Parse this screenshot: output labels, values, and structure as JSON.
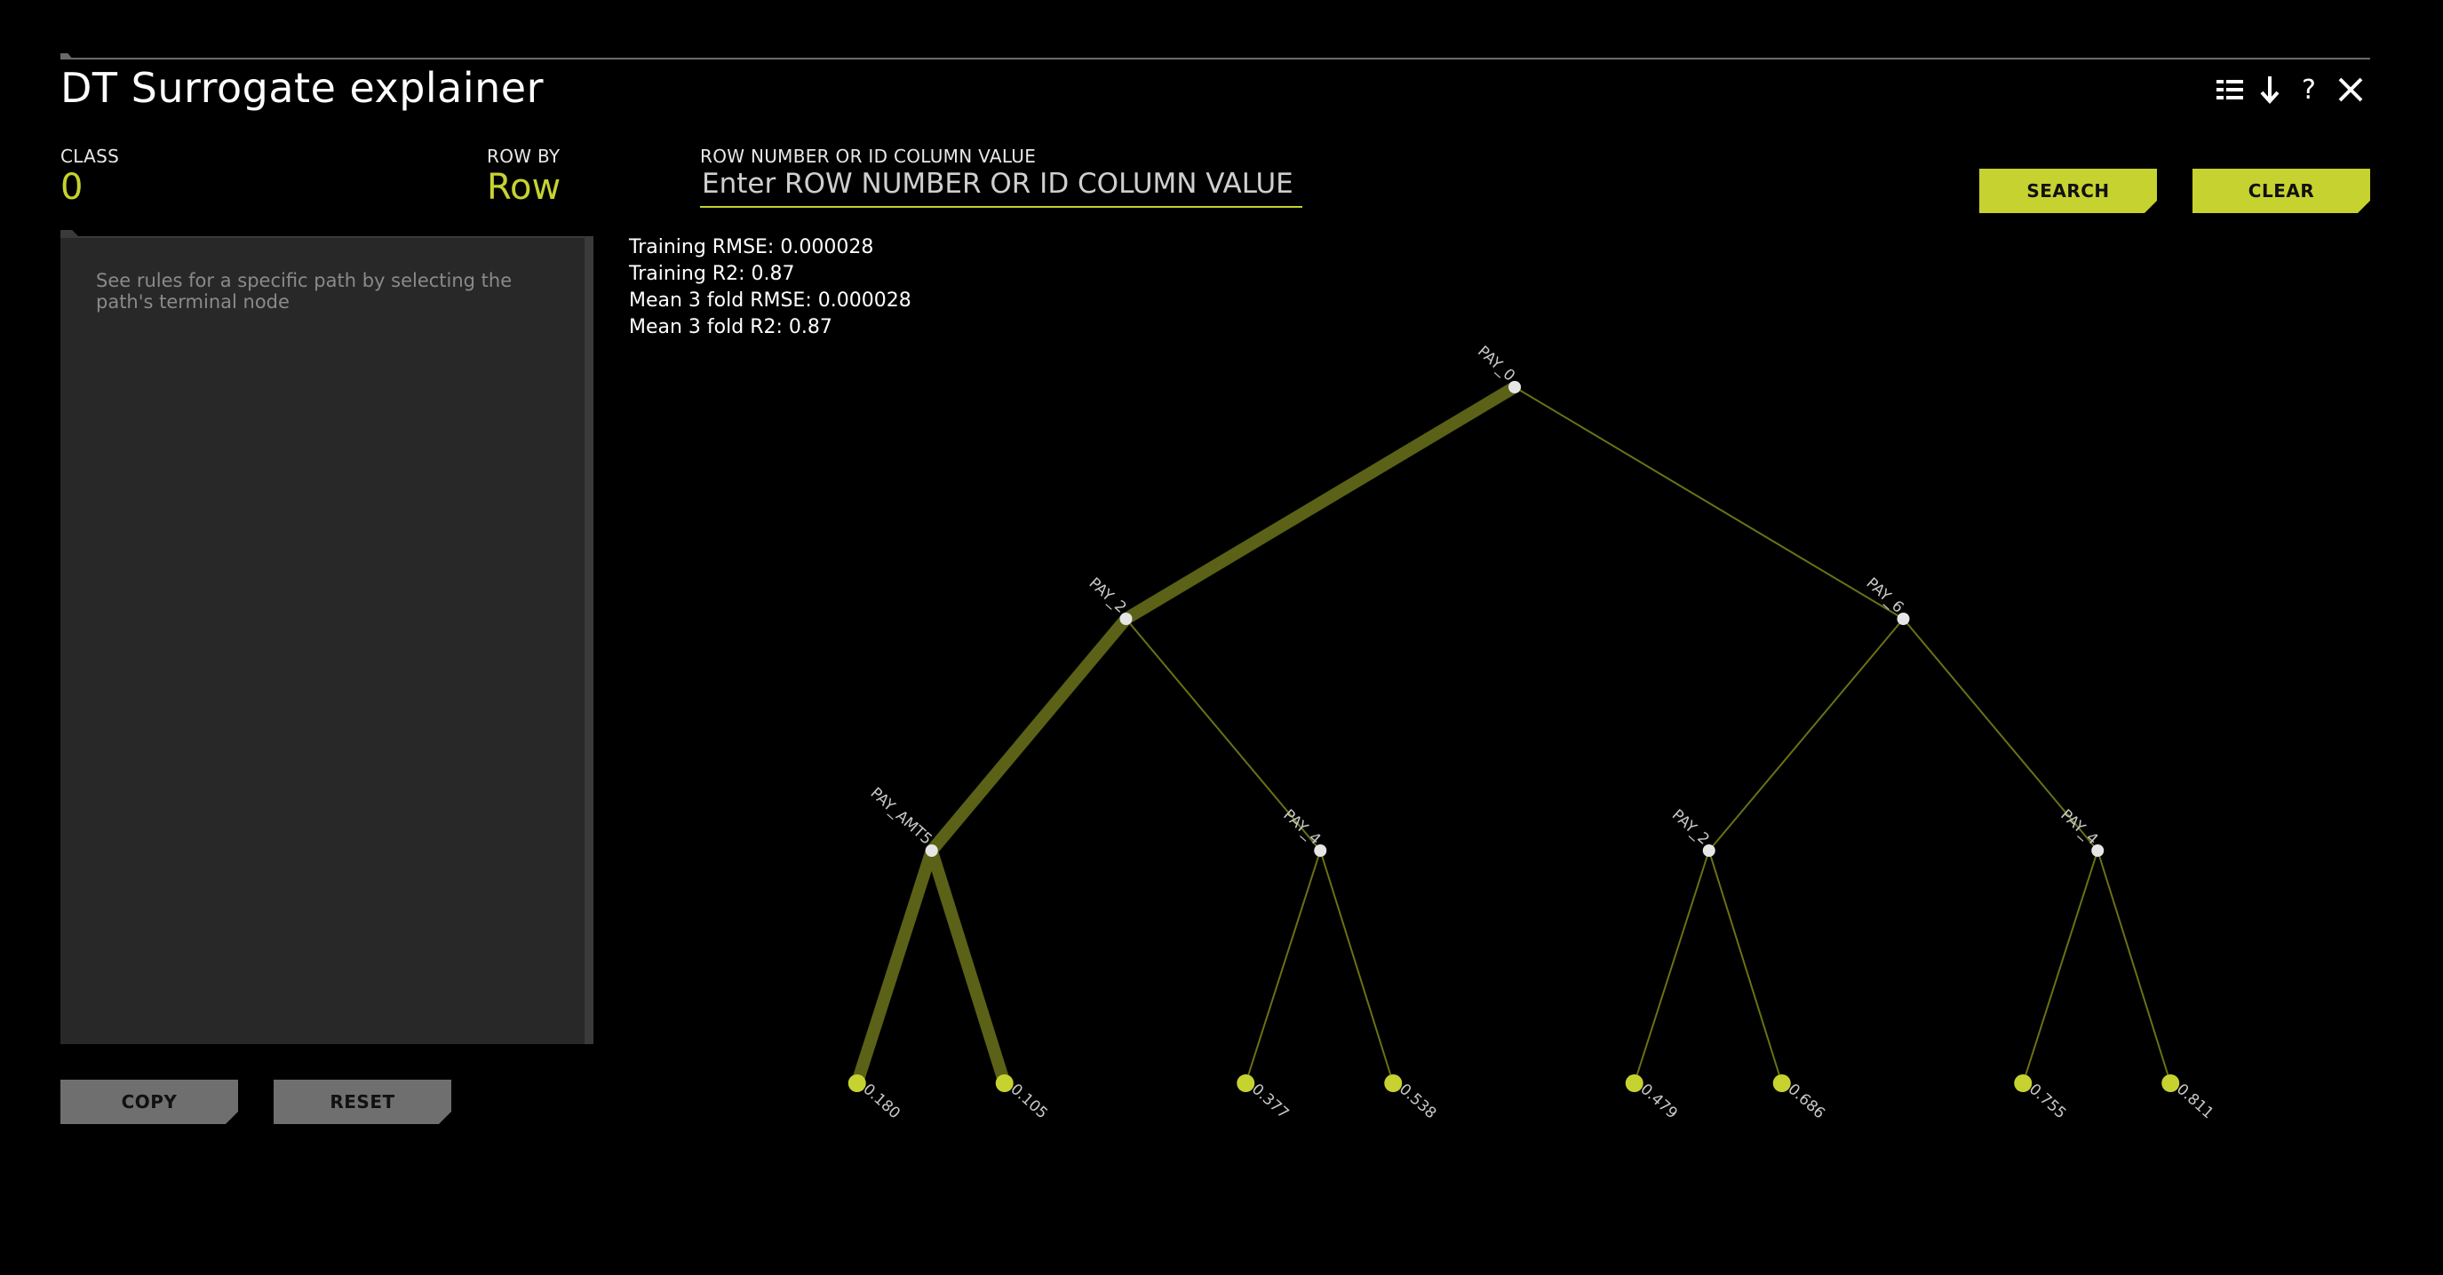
{
  "header": {
    "title": "DT Surrogate explainer",
    "toolbar": [
      {
        "name": "list-icon",
        "label": "list"
      },
      {
        "name": "download-icon",
        "label": "download"
      },
      {
        "name": "help-icon",
        "label": "?"
      },
      {
        "name": "close-icon",
        "label": "close"
      }
    ]
  },
  "controls": {
    "class_label": "CLASS",
    "class_value": "0",
    "row_by_label": "ROW BY",
    "row_by_value": "Row",
    "row_input_label": "ROW NUMBER OR ID COLUMN VALUE",
    "row_input_placeholder": "Enter ROW NUMBER OR ID COLUMN VALUE",
    "row_input_value": "",
    "search_label": "SEARCH",
    "clear_label": "CLEAR"
  },
  "rules_panel": {
    "hint": "See rules for a specific path by selecting the path's terminal node",
    "copy_label": "COPY",
    "reset_label": "RESET"
  },
  "metrics": {
    "training_rmse": "Training RMSE: 0.000028",
    "training_r2": "Training R2: 0.87",
    "cv_rmse": "Mean 3 fold RMSE: 0.000028",
    "cv_r2": "Mean 3 fold R2: 0.87"
  },
  "tree": {
    "accent_color": "#c6d230",
    "highlight_color": "#5b6116",
    "edge_color": "#6b7114",
    "node_color": "#e6e6e6",
    "nodes": [
      {
        "id": "n0",
        "label": "PAY_0",
        "depth": 0,
        "slot": 0
      },
      {
        "id": "n1",
        "label": "PAY_2",
        "depth": 1,
        "slot": 0
      },
      {
        "id": "n2",
        "label": "PAY_6",
        "depth": 1,
        "slot": 1
      },
      {
        "id": "n3",
        "label": "PAY_AMT5",
        "depth": 2,
        "slot": 0
      },
      {
        "id": "n4",
        "label": "PAY_4",
        "depth": 2,
        "slot": 1
      },
      {
        "id": "n5",
        "label": "PAY_2",
        "depth": 2,
        "slot": 2
      },
      {
        "id": "n6",
        "label": "PAY_4",
        "depth": 2,
        "slot": 3
      }
    ],
    "leaves": [
      {
        "id": "l0",
        "value": "0.180",
        "parent": "n3"
      },
      {
        "id": "l1",
        "value": "0.105",
        "parent": "n3"
      },
      {
        "id": "l2",
        "value": "0.377",
        "parent": "n4"
      },
      {
        "id": "l3",
        "value": "0.538",
        "parent": "n4"
      },
      {
        "id": "l4",
        "value": "0.479",
        "parent": "n5"
      },
      {
        "id": "l5",
        "value": "0.686",
        "parent": "n5"
      },
      {
        "id": "l6",
        "value": "0.755",
        "parent": "n6"
      },
      {
        "id": "l7",
        "value": "0.811",
        "parent": "n6"
      }
    ],
    "edges": [
      {
        "from": "n0",
        "to": "n1",
        "highlight": true
      },
      {
        "from": "n0",
        "to": "n2",
        "highlight": false
      },
      {
        "from": "n1",
        "to": "n3",
        "highlight": true
      },
      {
        "from": "n1",
        "to": "n4",
        "highlight": false
      },
      {
        "from": "n2",
        "to": "n5",
        "highlight": false
      },
      {
        "from": "n2",
        "to": "n6",
        "highlight": false
      },
      {
        "from": "n3",
        "to": "l0",
        "highlight": true
      },
      {
        "from": "n3",
        "to": "l1",
        "highlight": true
      },
      {
        "from": "n4",
        "to": "l2",
        "highlight": false
      },
      {
        "from": "n4",
        "to": "l3",
        "highlight": false
      },
      {
        "from": "n5",
        "to": "l4",
        "highlight": false
      },
      {
        "from": "n5",
        "to": "l5",
        "highlight": false
      },
      {
        "from": "n6",
        "to": "l6",
        "highlight": false
      },
      {
        "from": "n6",
        "to": "l7",
        "highlight": false
      }
    ]
  }
}
